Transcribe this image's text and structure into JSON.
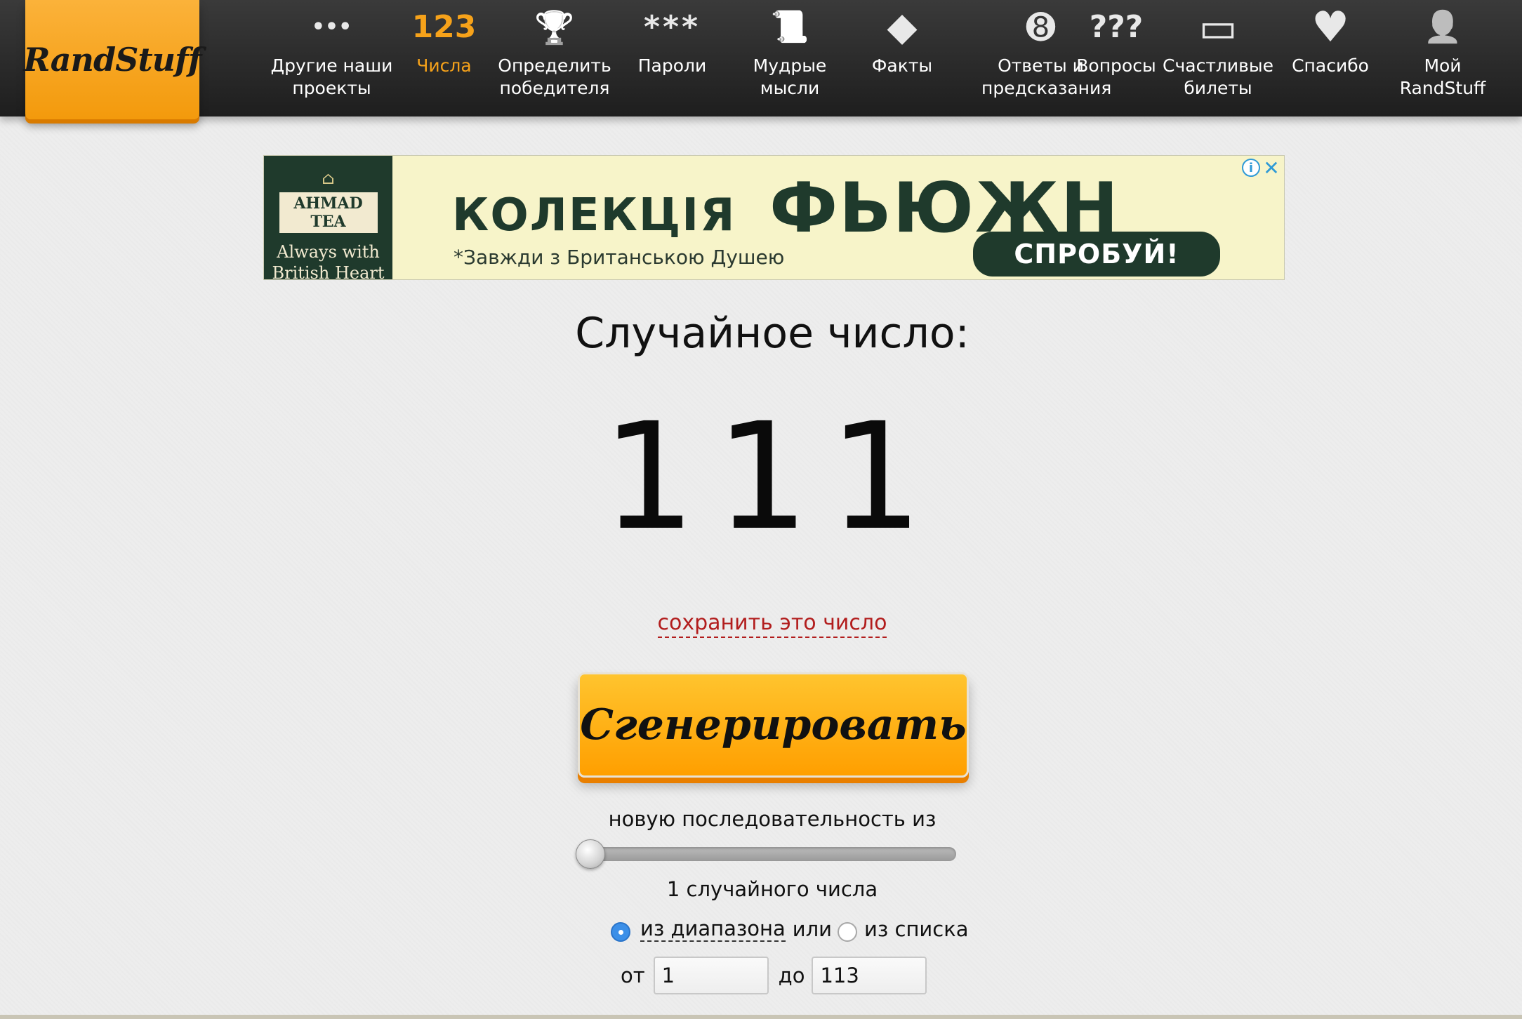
{
  "logo": {
    "text": "RandStuff"
  },
  "nav": {
    "items": [
      {
        "icon_name": "more-dots-icon",
        "icon_glyph": "•••",
        "label": "Другие наши проекты"
      },
      {
        "icon_name": "numbers-icon",
        "icon_glyph": "123",
        "label": "Числа",
        "active": true
      },
      {
        "icon_name": "trophy-icon",
        "icon_glyph": "🏆",
        "label": "Определить победителя"
      },
      {
        "icon_name": "password-icon",
        "icon_glyph": "***",
        "label": "Пароли"
      },
      {
        "icon_name": "scroll-icon",
        "icon_glyph": "📜",
        "label": "Мудрые мысли"
      },
      {
        "icon_name": "warning-diamond-icon",
        "icon_glyph": "◆",
        "label": "Факты"
      },
      {
        "icon_name": "eight-ball-icon",
        "icon_glyph": "➑",
        "label": "Ответы и предсказания"
      },
      {
        "icon_name": "questions-icon",
        "icon_glyph": "???",
        "label": "Вопросы"
      },
      {
        "icon_name": "ticket-icon",
        "icon_glyph": "▭",
        "label": "Счастливые билеты"
      },
      {
        "icon_name": "heart-icon",
        "icon_glyph": "♥",
        "label": "Спасибо"
      },
      {
        "icon_name": "user-icon",
        "icon_glyph": "👤",
        "label": "Мой RandStuff"
      }
    ]
  },
  "ad": {
    "brand_name": "AHMAD TEA",
    "brand_slogan": "Always with British Heart",
    "title_part1": "КОЛЕКЦІЯ",
    "title_part2": "ФЬЮЖН",
    "subtitle": "*Завжди з Британською Душею",
    "cta": "СПРОБУЙ!",
    "info_glyph": "i",
    "close_glyph": "✕"
  },
  "main": {
    "heading": "Случайное число:",
    "result": "111",
    "save_link": "сохранить это число",
    "generate_button": "Сгенерировать",
    "sequence_label": "новую последовательность из",
    "slider_value": 1,
    "count_label": "1 случайного числа",
    "radio_range_label": "из диапазона",
    "radio_or": "или",
    "radio_list_label": "из списка",
    "selected_mode": "range",
    "from_label": "от",
    "from_value": "1",
    "to_label": "до",
    "to_value": "113"
  }
}
